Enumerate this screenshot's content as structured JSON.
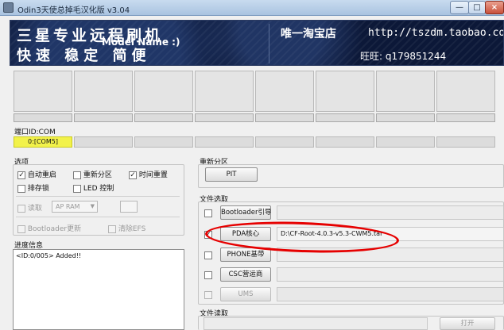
{
  "window": {
    "title": "Odin3天使总掉毛汉化版 v3.04"
  },
  "banner": {
    "line1": "三星专业远程刷机",
    "line2": "快速 稳定 简便",
    "model_label": "Model Name :)",
    "shop": "唯一淘宝店",
    "url": "http://tszdm.taobao.com",
    "wangwang": "旺旺: q179851244"
  },
  "port": {
    "label": "端口ID:COM",
    "slots": [
      "0:[COM5]",
      "",
      "",
      "",
      "",
      "",
      "",
      ""
    ],
    "active_index": 0
  },
  "options": {
    "title": "选项",
    "items": [
      {
        "label": "自动重启",
        "checked": true,
        "enabled": true
      },
      {
        "label": "重新分区",
        "checked": false,
        "enabled": true
      },
      {
        "label": "时间重置",
        "checked": true,
        "enabled": true
      },
      {
        "label": "排存锁",
        "checked": false,
        "enabled": true
      },
      {
        "label": "LED 控制",
        "checked": false,
        "enabled": true
      }
    ],
    "read_label": "读取",
    "ap_ram": "AP RAM",
    "bootloader_update": "Bootloader更新",
    "clear_efs": "清除EFS"
  },
  "log": {
    "title": "进度信息",
    "lines": [
      "<ID:0/005> Added!!"
    ]
  },
  "repartition": {
    "title": "重新分区",
    "pit_label": "PIT"
  },
  "files": {
    "title": "文件选取",
    "rows": [
      {
        "label": "Bootloader引导",
        "path": "",
        "checked": false,
        "enabled": true
      },
      {
        "label": "PDA核心",
        "path": "D:\\CF-Root-4.0.3-v5.3-CWM5.tar",
        "checked": true,
        "enabled": true
      },
      {
        "label": "PHONE基带",
        "path": "",
        "checked": false,
        "enabled": true
      },
      {
        "label": "CSC营运商",
        "path": "",
        "checked": false,
        "enabled": true
      },
      {
        "label": "UMS",
        "path": "",
        "checked": false,
        "enabled": false
      }
    ]
  },
  "dump": {
    "title": "文件读取",
    "open_label": "打开"
  },
  "colors": {
    "active_port": "#f2f24a",
    "annotation": "#e60000",
    "banner_bg": "#0c1838"
  }
}
